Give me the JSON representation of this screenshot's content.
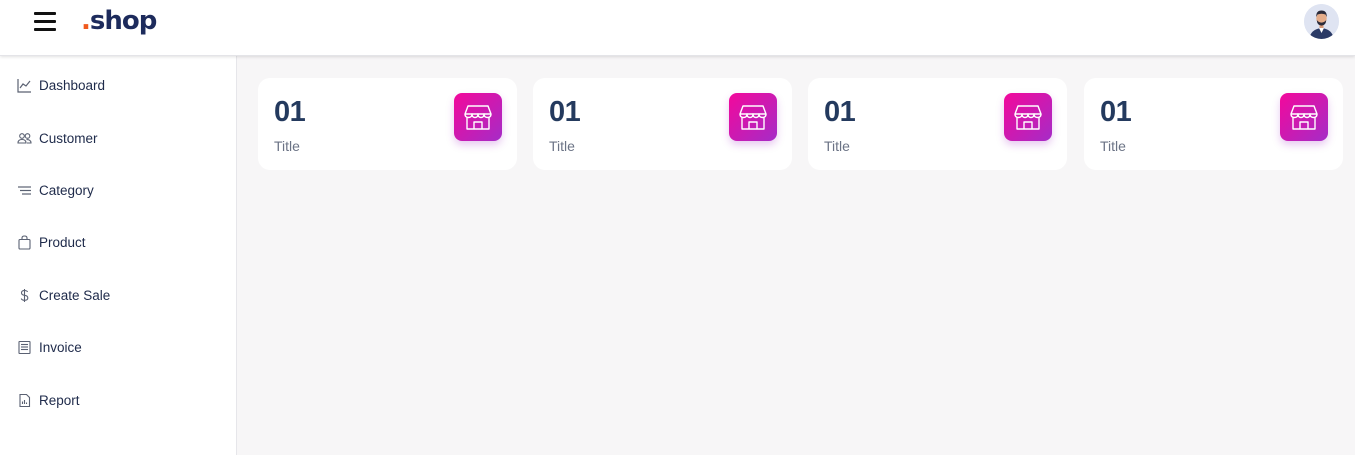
{
  "header": {
    "menu_icon": "hamburger-icon",
    "logo_dot": ".",
    "logo_text": "shop",
    "avatar_icon": "user-avatar-icon"
  },
  "sidebar": {
    "items": [
      {
        "label": "Dashboard",
        "icon": "line-chart-icon"
      },
      {
        "label": "Customer",
        "icon": "users-icon"
      },
      {
        "label": "Category",
        "icon": "list-icon"
      },
      {
        "label": "Product",
        "icon": "shopping-bag-icon"
      },
      {
        "label": "Create Sale",
        "icon": "dollar-icon"
      },
      {
        "label": "Invoice",
        "icon": "invoice-icon"
      },
      {
        "label": "Report",
        "icon": "report-icon"
      }
    ]
  },
  "cards": [
    {
      "value": "01",
      "title": "Title",
      "icon": "store-icon"
    },
    {
      "value": "01",
      "title": "Title",
      "icon": "store-icon"
    },
    {
      "value": "01",
      "title": "Title",
      "icon": "store-icon"
    },
    {
      "value": "01",
      "title": "Title",
      "icon": "store-icon"
    }
  ],
  "colors": {
    "brand_navy": "#1d2b5c",
    "brand_accent": "#f05a1e",
    "card_icon_gradient_start": "#f3089b",
    "card_icon_gradient_end": "#a52cc7",
    "background": "#f7f6f7"
  }
}
